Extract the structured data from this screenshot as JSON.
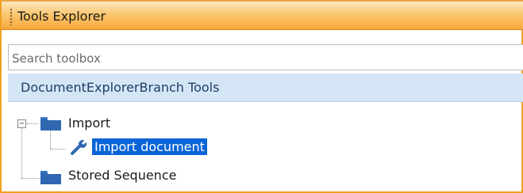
{
  "window": {
    "title": "Tools Explorer"
  },
  "search": {
    "placeholder": "Search toolbox"
  },
  "group": {
    "label": "DocumentExplorerBranch Tools"
  },
  "tree": {
    "nodes": [
      {
        "label": "Import",
        "icon": "folder-icon",
        "expanded": true
      },
      {
        "label": "Import document",
        "icon": "wrench-icon",
        "selected": true
      },
      {
        "label": "Stored Sequence",
        "icon": "folder-icon"
      }
    ]
  },
  "colors": {
    "titlebar": "#f8a73a",
    "group_header": "#d4e6f6",
    "selection": "#0a64d8",
    "folder": "#2f67b0"
  }
}
